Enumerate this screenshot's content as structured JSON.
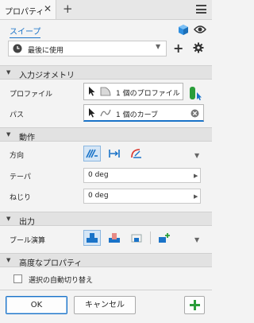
{
  "tab": {
    "label": "プロパティ"
  },
  "feature": {
    "name": "スイープ"
  },
  "dropdown": {
    "value": "最後に使用"
  },
  "sections": {
    "input_geometry": "入力ジオメトリ",
    "motion": "動作",
    "output": "出力",
    "advanced": "高度なプロパティ"
  },
  "input_geometry": {
    "profile_label": "プロファイル",
    "profile_value": "1 個のプロファイル",
    "path_label": "パス",
    "path_value": "1 個のカーブ"
  },
  "motion": {
    "direction_label": "方向",
    "taper_label": "テーパ",
    "taper_value": "0 deg",
    "twist_label": "ねじり",
    "twist_value": "0 deg"
  },
  "output": {
    "boolean_label": "ブール演算"
  },
  "advanced": {
    "auto_select_label": "選択の自動切り替え"
  },
  "buttons": {
    "ok": "OK",
    "cancel": "キャンセル"
  },
  "colors": {
    "accent": "#1a73c8",
    "green": "#2a9d3a"
  }
}
